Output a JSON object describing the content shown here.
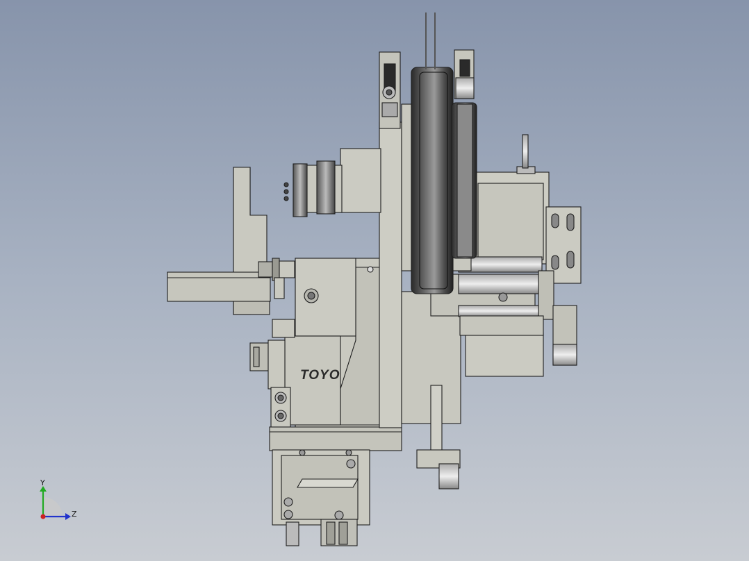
{
  "viewport": {
    "background_top": "#8794ab",
    "background_bottom": "#c8ccd2",
    "part_fill": "#c9c9c0",
    "part_edge": "#1e1e1e",
    "wheel_dark": "#3a3a3a"
  },
  "model": {
    "brand_logo": "TOYO"
  },
  "triad": {
    "y_label": "Y",
    "z_label": "Z",
    "y_color": "#22aa22",
    "z_color": "#2233cc",
    "x_color": "#cc2222"
  }
}
